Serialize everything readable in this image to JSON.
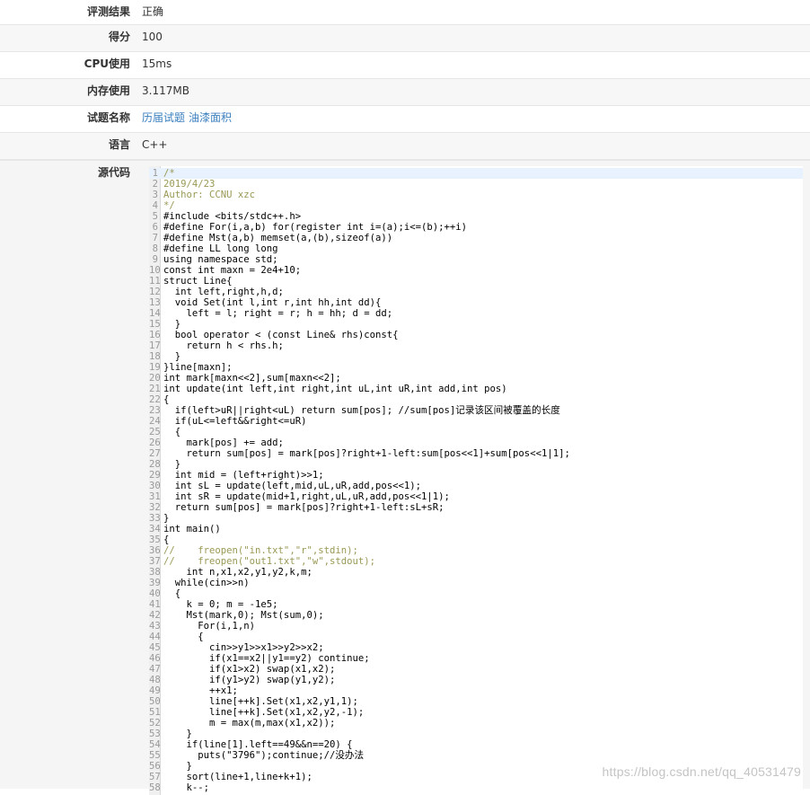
{
  "info": {
    "rows": [
      {
        "label": "评测结果",
        "value": "正确"
      },
      {
        "label": "得分",
        "value": "100"
      },
      {
        "label": "CPU使用",
        "value": "15ms"
      },
      {
        "label": "内存使用",
        "value": "3.117MB"
      },
      {
        "label": "试题名称",
        "links": [
          "历届试题",
          "油漆面积"
        ]
      },
      {
        "label": "语言",
        "value": "C++"
      }
    ]
  },
  "source": {
    "label": "源代码",
    "lines": [
      "/*",
      "2019/4/23",
      "Author: CCNU xzc",
      "*/",
      "#include <bits/stdc++.h>",
      "#define For(i,a,b) for(register int i=(a);i<=(b);++i)",
      "#define Mst(a,b) memset(a,(b),sizeof(a))",
      "#define LL long long",
      "using namespace std;",
      "const int maxn = 2e4+10;",
      "struct Line{",
      "  int left,right,h,d;",
      "  void Set(int l,int r,int hh,int dd){",
      "    left = l; right = r; h = hh; d = dd;",
      "  }",
      "  bool operator < (const Line& rhs)const{",
      "    return h < rhs.h;",
      "  }",
      "}line[maxn];",
      "int mark[maxn<<2],sum[maxn<<2];",
      "int update(int left,int right,int uL,int uR,int add,int pos)",
      "{",
      "  if(left>uR||right<uL) return sum[pos]; //sum[pos]记录该区间被覆盖的长度",
      "  if(uL<=left&&right<=uR)",
      "  {",
      "    mark[pos] += add;",
      "    return sum[pos] = mark[pos]?right+1-left:sum[pos<<1]+sum[pos<<1|1];",
      "  }",
      "  int mid = (left+right)>>1;",
      "  int sL = update(left,mid,uL,uR,add,pos<<1);",
      "  int sR = update(mid+1,right,uL,uR,add,pos<<1|1);",
      "  return sum[pos] = mark[pos]?right+1-left:sL+sR;",
      "}",
      "int main()",
      "{",
      "//    freopen(\"in.txt\",\"r\",stdin);",
      "//    freopen(\"out1.txt\",\"w\",stdout);",
      "    int n,x1,x2,y1,y2,k,m;",
      "  while(cin>>n)",
      "  {",
      "    k = 0; m = -1e5;",
      "    Mst(mark,0); Mst(sum,0);",
      "      For(i,1,n)",
      "      {",
      "        cin>>y1>>x1>>y2>>x2;",
      "        if(x1==x2||y1==y2) continue;",
      "        if(x1>x2) swap(x1,x2);",
      "        if(y1>y2) swap(y1,y2);",
      "        ++x1;",
      "        line[++k].Set(x1,x2,y1,1);",
      "        line[++k].Set(x1,x2,y2,-1);",
      "        m = max(m,max(x1,x2));",
      "    }",
      "    if(line[1].left==49&&n==20) {",
      "      puts(\"3796\");continue;//没办法",
      "    }",
      "    sort(line+1,line+k+1);",
      "    k--;"
    ]
  },
  "watermark": "https://blog.csdn.net/qq_40531479",
  "colors": {
    "keyword": "#0000cc",
    "comment": "#999955",
    "number": "#cc0000",
    "link": "#3a7fbf"
  }
}
